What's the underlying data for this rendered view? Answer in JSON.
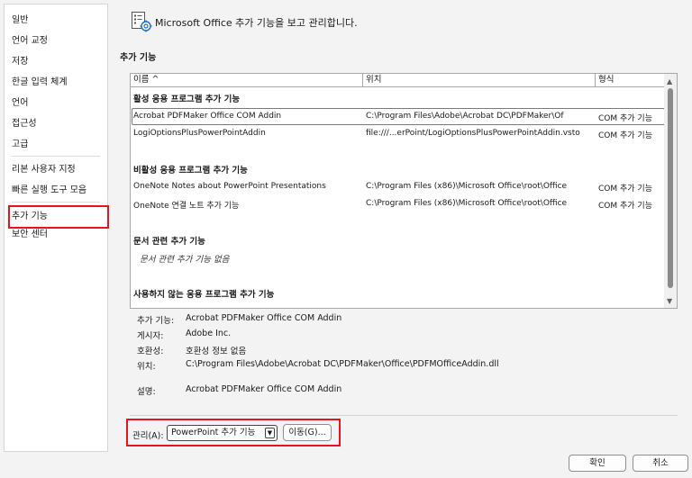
{
  "nav": {
    "items": [
      "일반",
      "언어 교정",
      "저장",
      "한글 입력 체계",
      "언어",
      "접근성",
      "고급",
      "리본 사용자 지정",
      "빠른 실행 도구 모음",
      "추가 기능",
      "보안 센터"
    ]
  },
  "header": {
    "title": "Microsoft Office 추가 기능을 보고 관리합니다."
  },
  "section_title": "추가 기능",
  "table": {
    "columns": [
      "이름 ^",
      "위치",
      "형식"
    ],
    "groups": [
      {
        "title": "활성 응용 프로그램 추가 기능",
        "rows": [
          {
            "name": "Acrobat PDFMaker Office COM Addin",
            "location": "C:\\Program Files\\Adobe\\Acrobat DC\\PDFMaker\\Of",
            "type": "COM 추가 기능"
          },
          {
            "name": "LogiOptionsPlusPowerPointAddin",
            "location": "file:///...erPoint/LogiOptionsPlusPowerPointAddin.vsto",
            "type": "COM 추가 기능"
          }
        ]
      },
      {
        "title": "비활성 응용 프로그램 추가 기능",
        "rows": [
          {
            "name": "OneNote Notes about PowerPoint Presentations",
            "location": "C:\\Program Files (x86)\\Microsoft Office\\root\\Office",
            "type": "COM 추가 기능"
          },
          {
            "name": "OneNote 연결 노트 추가 기능",
            "location": "C:\\Program Files (x86)\\Microsoft Office\\root\\Office",
            "type": "COM 추가 기능"
          }
        ]
      },
      {
        "title": "문서 관련 추가 기능",
        "empty": "문서 관련 추가 기능 없음"
      },
      {
        "title": "사용하지 않는 응용 프로그램 추가 기능"
      }
    ]
  },
  "details": {
    "addin_label": "추가 기능:",
    "addin_value": "Acrobat PDFMaker Office COM Addin",
    "publisher_label": "게시자:",
    "publisher_value": "Adobe Inc.",
    "compat_label": "호환성:",
    "compat_value": "호환성 정보 없음",
    "location_label": "위치:",
    "location_value": "C:\\Program Files\\Adobe\\Acrobat DC\\PDFMaker\\Office\\PDFMOfficeAddin.dll",
    "desc_label": "설명:",
    "desc_value": "Acrobat PDFMaker Office COM Addin"
  },
  "manage": {
    "label": "관리(A):",
    "selected": "PowerPoint 추가 기능",
    "go_button": "이동(G)..."
  },
  "footer": {
    "ok": "확인",
    "cancel": "취소"
  },
  "colors": {
    "highlight_border": "#e8141d"
  },
  "icons": [
    "addins-gear-icon",
    "chevron-down-icon",
    "scroll-up-icon",
    "scroll-down-icon"
  ]
}
